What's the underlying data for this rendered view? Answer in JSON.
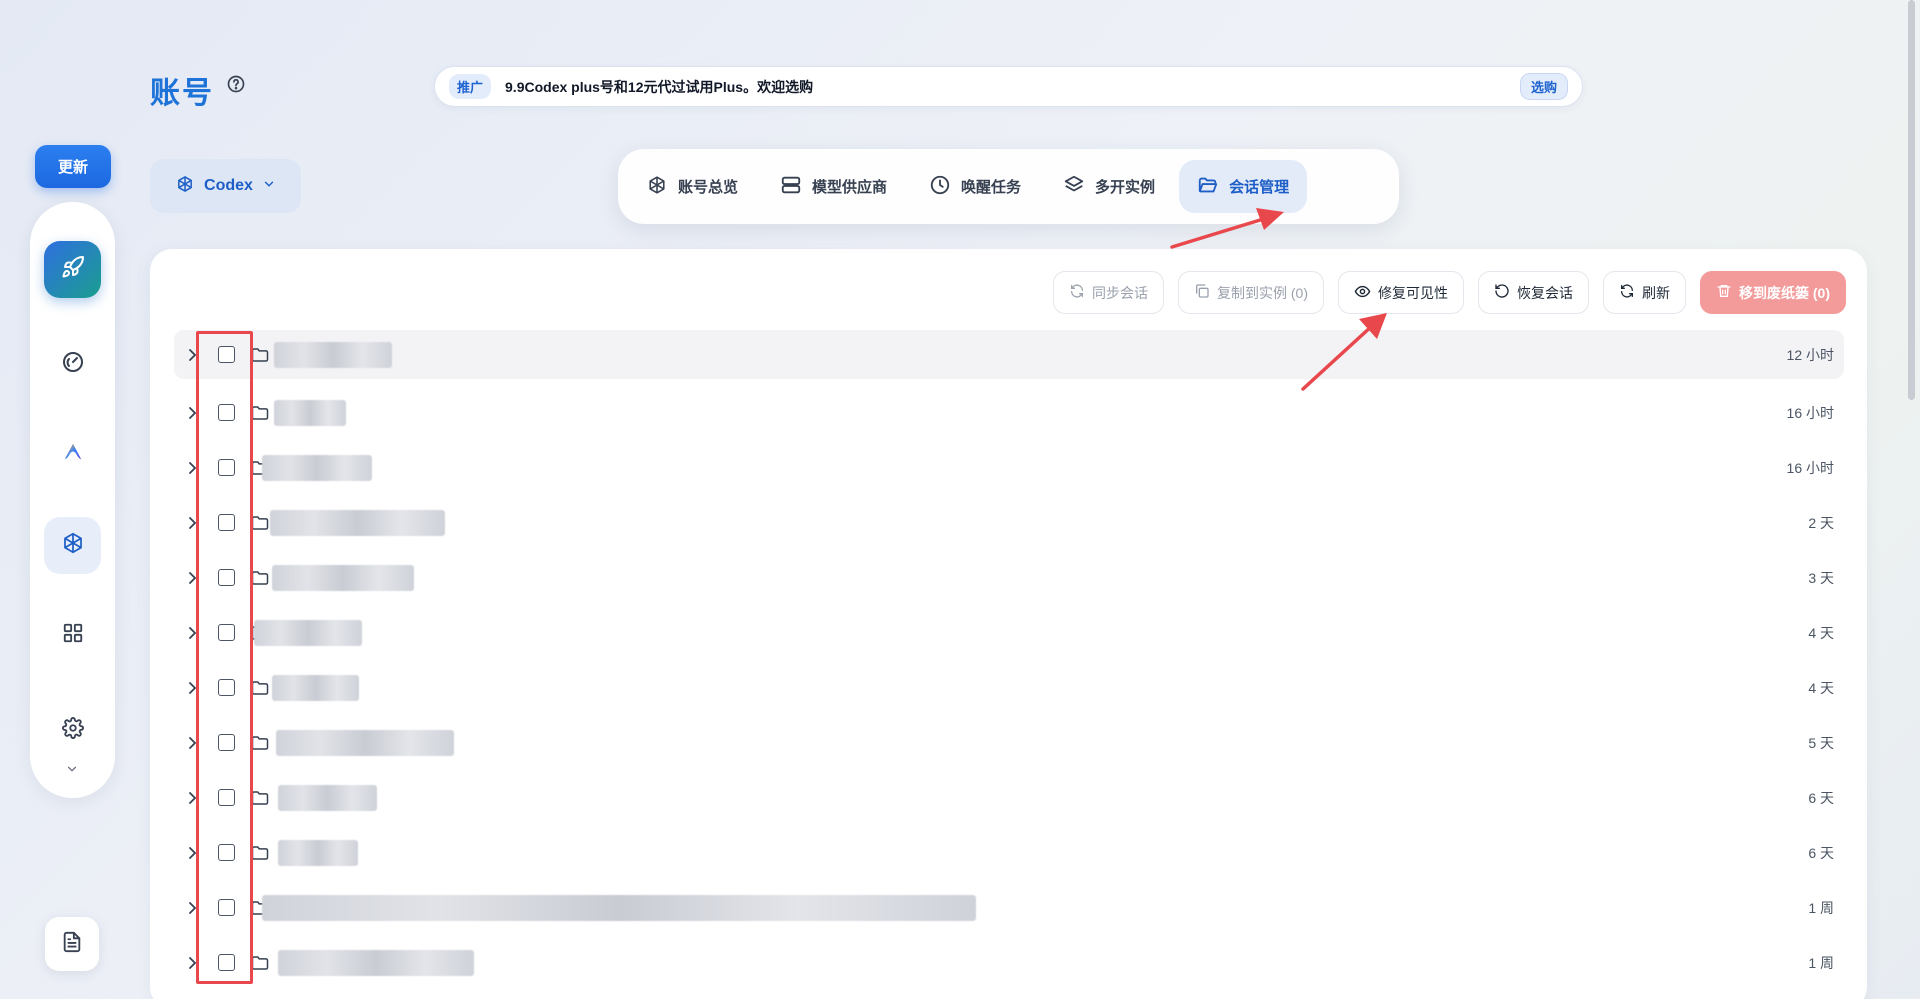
{
  "sidebar": {
    "update_label": "更新",
    "items": [
      {
        "icon": "rocket-icon",
        "state": "active"
      },
      {
        "icon": "gauge-icon",
        "state": "normal"
      },
      {
        "icon": "antigravity-logo-icon",
        "state": "normal"
      },
      {
        "icon": "openai-logo-icon",
        "state": "selected"
      },
      {
        "icon": "grid-icon",
        "state": "normal"
      },
      {
        "icon": "gear-icon",
        "state": "normal"
      }
    ],
    "more_icon": "chevron-down-icon",
    "doc_icon": "document-icon"
  },
  "header": {
    "title": "账号",
    "help_icon": "question-circle-icon",
    "promo": {
      "tag": "推广",
      "text": "9.9Codex plus号和12元代过试用Plus。欢迎选购",
      "button": "选购"
    }
  },
  "platform_select": {
    "label": "Codex",
    "icon": "openai-logo-icon"
  },
  "tabs": [
    {
      "label": "账号总览",
      "icon": "openai-logo-icon",
      "active": false
    },
    {
      "label": "模型供应商",
      "icon": "server-icon",
      "active": false
    },
    {
      "label": "唤醒任务",
      "icon": "clock-icon",
      "active": false
    },
    {
      "label": "多开实例",
      "icon": "layers-icon",
      "active": false
    },
    {
      "label": "会话管理",
      "icon": "folder-open-icon",
      "active": true
    }
  ],
  "toolbar": {
    "sync": "同步会话",
    "copy": "复制到实例 (0)",
    "fix_visibility": "修复可见性",
    "restore": "恢复会话",
    "refresh": "刷新",
    "trash": "移到废纸篓 (0)"
  },
  "sessions": [
    {
      "time": "12 小时",
      "checked": false
    },
    {
      "time": "16 小时",
      "checked": false
    },
    {
      "time": "16 小时",
      "checked": false
    },
    {
      "time": "2 天",
      "checked": false
    },
    {
      "time": "3 天",
      "checked": false
    },
    {
      "time": "4 天",
      "checked": false
    },
    {
      "time": "4 天",
      "checked": false
    },
    {
      "time": "5 天",
      "checked": false
    },
    {
      "time": "6 天",
      "checked": false
    },
    {
      "time": "6 天",
      "checked": false
    },
    {
      "time": "1 周",
      "checked": false
    },
    {
      "time": "1 周",
      "checked": false
    }
  ],
  "colors": {
    "accent": "#1e73d8",
    "annotation": "#e8474b",
    "danger": "#f39a9a"
  }
}
